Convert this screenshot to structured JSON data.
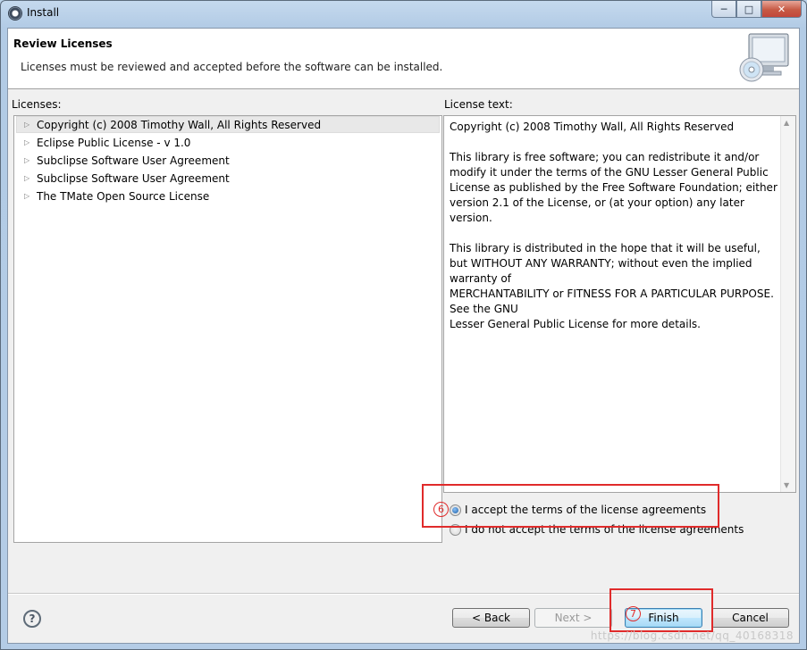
{
  "window": {
    "title": "Install",
    "buttons": {
      "minimize": "─",
      "maximize": "□",
      "close": "✕"
    }
  },
  "header": {
    "title": "Review Licenses",
    "description": "Licenses must be reviewed and accepted before the software can be installed.",
    "icon": "install-cd-monitor-icon"
  },
  "licenses": {
    "label": "Licenses:",
    "items": [
      {
        "label": "Copyright (c) 2008 Timothy Wall, All Rights Reserved",
        "selected": true
      },
      {
        "label": "Eclipse Public License - v 1.0"
      },
      {
        "label": "Subclipse Software User Agreement"
      },
      {
        "label": "Subclipse Software User Agreement"
      },
      {
        "label": "The TMate Open Source License"
      }
    ]
  },
  "license_text": {
    "label": "License text:",
    "paragraphs": [
      "Copyright (c) 2008 Timothy Wall, All Rights Reserved",
      "This library is free software; you can redistribute it and/or\nmodify it under the terms of the GNU Lesser General Public\nLicense as published by the Free Software Foundation; either\nversion 2.1 of the License, or (at your option) any later version.",
      "This library is distributed in the hope that it will be useful,\nbut WITHOUT ANY WARRANTY; without even the implied\nwarranty of\nMERCHANTABILITY or FITNESS FOR A PARTICULAR PURPOSE.\nSee the GNU\nLesser General Public License for more details."
    ]
  },
  "agreement": {
    "accept": "I accept the terms of the license agreements",
    "decline": "I do not accept the terms of the license agreements",
    "selected": "accept"
  },
  "annotations": {
    "step6": "6",
    "step7": "7",
    "color": "#e02b2b"
  },
  "footer": {
    "help": "?",
    "back": "< Back",
    "next": "Next >",
    "finish": "Finish",
    "cancel": "Cancel"
  },
  "watermark": "https://blog.csdn.net/qq_40168318"
}
